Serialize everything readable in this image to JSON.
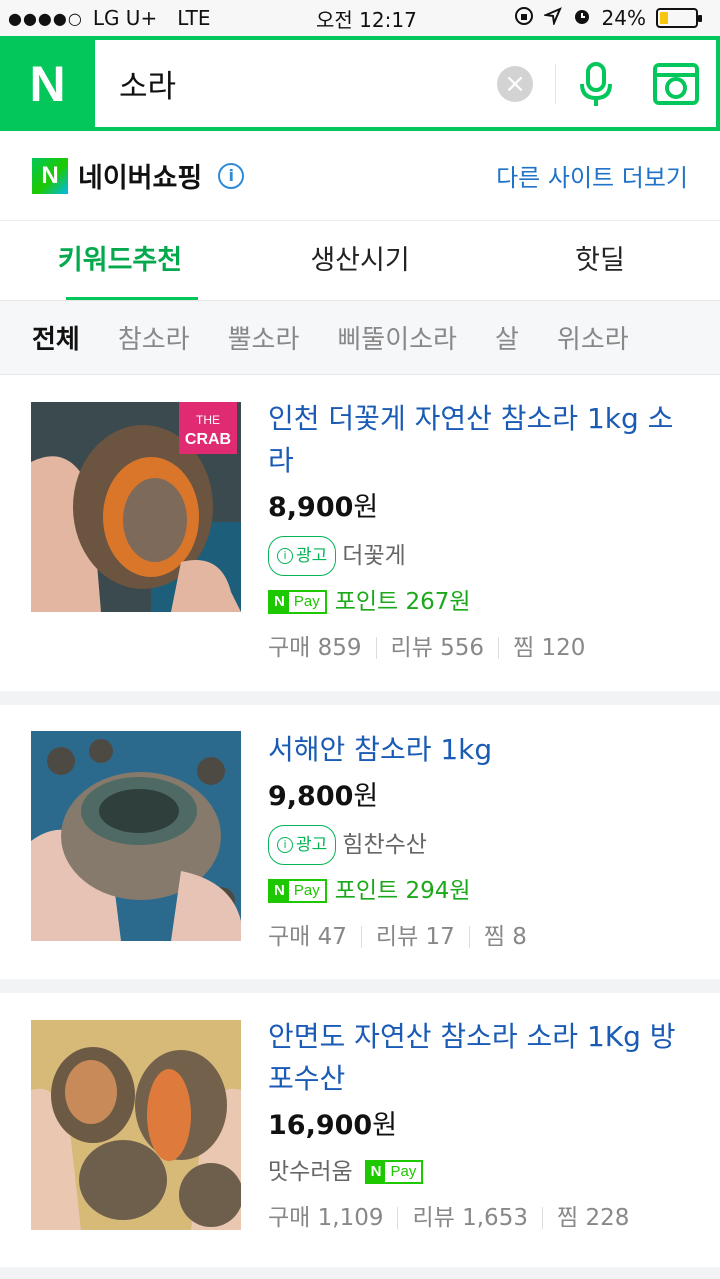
{
  "status": {
    "carrier": "LG U+",
    "network": "LTE",
    "time": "오전 12:17",
    "battery": "24%",
    "battery_level": 0.24
  },
  "search": {
    "logo": "N",
    "query": "소라",
    "clear": "×"
  },
  "brand": {
    "logo": "N",
    "title": "네이버쇼핑",
    "info": "i",
    "more_sites": "다른 사이트 더보기"
  },
  "tabs": [
    {
      "label": "키워드추천",
      "active": true
    },
    {
      "label": "생산시기",
      "active": false
    },
    {
      "label": "핫딜",
      "active": false
    }
  ],
  "filters": [
    {
      "label": "전체",
      "active": true
    },
    {
      "label": "참소라"
    },
    {
      "label": "뿔소라"
    },
    {
      "label": "삐뚤이소라"
    },
    {
      "label": "살"
    },
    {
      "label": "위소라"
    }
  ],
  "products": [
    {
      "title": "인천 더꽃게 자연산 참소라 1kg 소라",
      "price": "8,900",
      "currency": "원",
      "ad_label": "광고",
      "seller": "더꽃게",
      "pay_n": "N",
      "pay_text": "Pay",
      "points": "포인트 267원",
      "stats": [
        "구매 859",
        "리뷰 556",
        "찜 120"
      ],
      "thumb_badge_line1": "THE",
      "thumb_badge_line2": "CRAB"
    },
    {
      "title": "서해안 참소라 1kg",
      "price": "9,800",
      "currency": "원",
      "ad_label": "광고",
      "seller": "힘찬수산",
      "pay_n": "N",
      "pay_text": "Pay",
      "points": "포인트 294원",
      "stats": [
        "구매 47",
        "리뷰 17",
        "찜 8"
      ]
    },
    {
      "title": "안면도 자연산 참소라 소라 1Kg 방포수산",
      "price": "16,900",
      "currency": "원",
      "seller": "맛수러움",
      "pay_n": "N",
      "pay_text": "Pay",
      "stats": [
        "구매 1,109",
        "리뷰 1,653",
        "찜 228"
      ]
    }
  ],
  "colors": {
    "naver_green": "#03c75a",
    "link_blue": "#1a5bb5",
    "pay_green": "#1ec800"
  }
}
